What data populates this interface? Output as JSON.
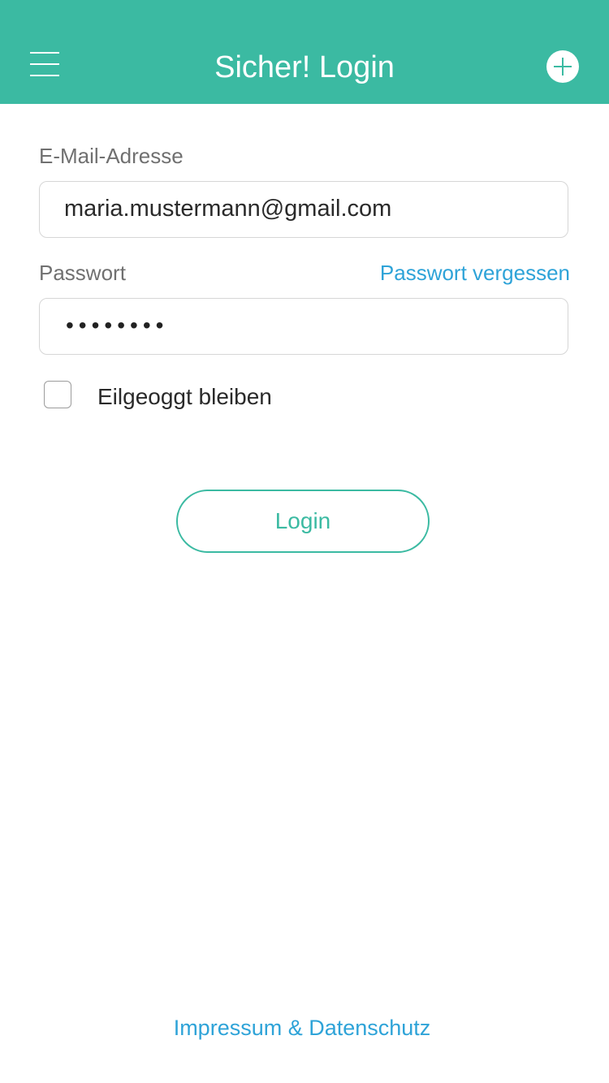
{
  "header": {
    "title": "Sicher! Login",
    "menu_icon": "hamburger-menu-icon",
    "add_icon": "plus-circle-icon",
    "background_color": "#3bbaa2"
  },
  "form": {
    "email_label": "E-Mail-Adresse",
    "email_value": "maria.mustermann@gmail.com",
    "password_label": "Passwort",
    "forgot_password_link": "Passwort vergessen",
    "password_value": "••••••••",
    "remember_label": "Eilgeoggt bleiben",
    "remember_checked": false,
    "login_button_label": "Login"
  },
  "footer": {
    "imprint_link": "Impressum & Datenschutz"
  },
  "colors": {
    "accent": "#3bbaa2",
    "link": "#2ea3d8"
  }
}
